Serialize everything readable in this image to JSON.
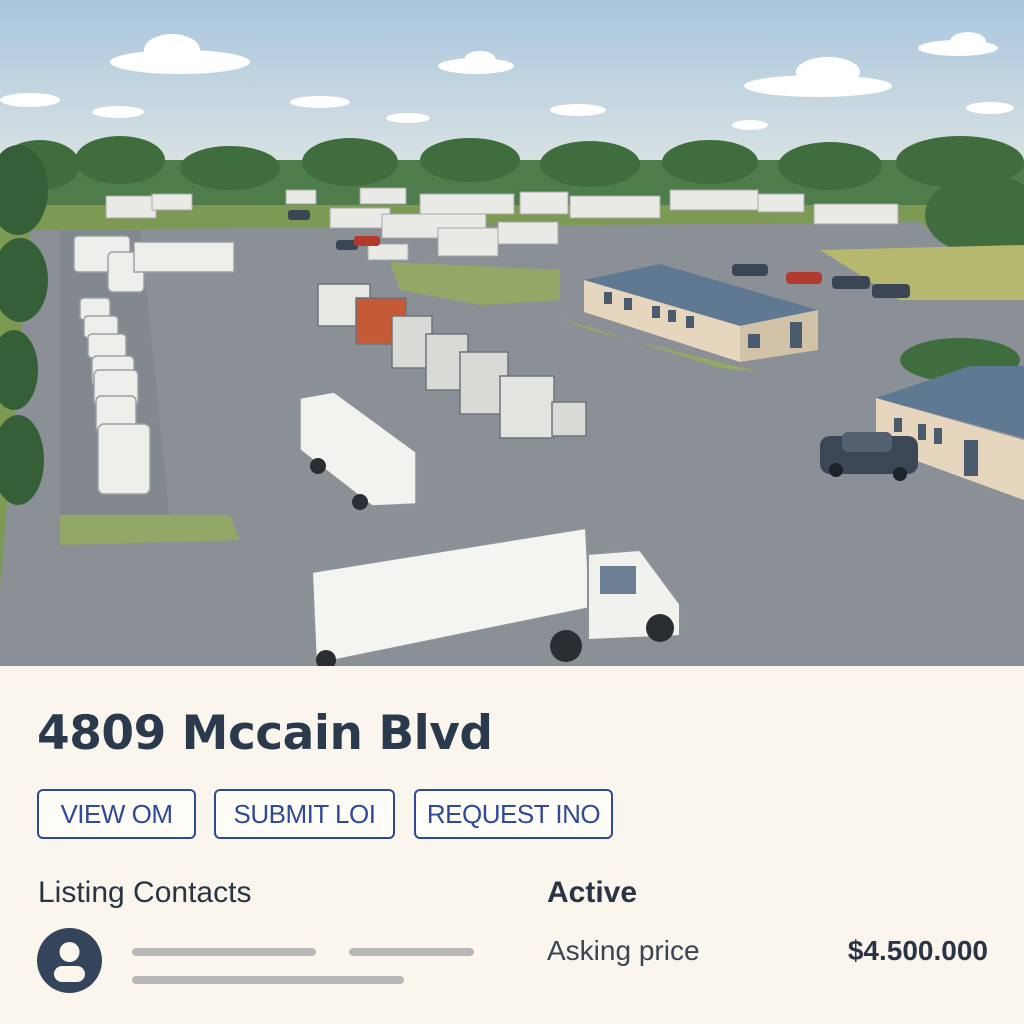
{
  "hero": {
    "image_alt": "Aerial view of a truck terminal with parked trucks, trailers and low industrial buildings"
  },
  "listing": {
    "address": "4809 Mccain Blvd",
    "actions": {
      "view_om": "VIEW OM",
      "submit_loi": "SUBMIT LOI",
      "request_info": "REQUEST INO"
    },
    "contacts_heading": "Listing Contacts",
    "status": "Active",
    "asking_price_label": "Asking price",
    "asking_price": "$4.500.000"
  },
  "colors": {
    "accent": "#2f4a9a",
    "heading": "#2a3a4c",
    "background": "#faf6ee",
    "avatar": "#34445a",
    "placeholder": "#b8b8b8"
  },
  "icons": {
    "avatar": "user-icon"
  }
}
